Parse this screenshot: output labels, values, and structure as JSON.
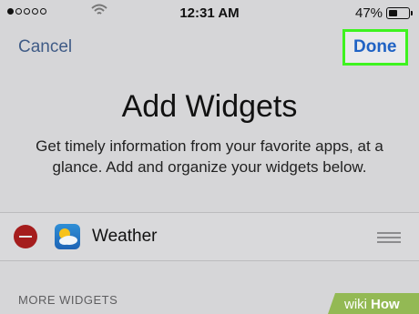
{
  "status_bar": {
    "signal_dots_filled": 1,
    "signal_dots_total": 5,
    "time": "12:31 AM",
    "battery_percent": "47%",
    "battery_level": 0.47
  },
  "nav": {
    "cancel_label": "Cancel",
    "done_label": "Done"
  },
  "header": {
    "title": "Add Widgets",
    "subtitle": "Get timely information from your favorite apps, at a glance. Add and organize your widgets below."
  },
  "widgets": [
    {
      "name": "Weather",
      "icon": "weather-icon"
    }
  ],
  "more_widgets_label": "MORE WIDGETS",
  "colors": {
    "accent": "#1f62c4",
    "highlight": "#3ef31f",
    "remove": "#a51d1d"
  },
  "watermark": {
    "brand": "wikiHow"
  }
}
